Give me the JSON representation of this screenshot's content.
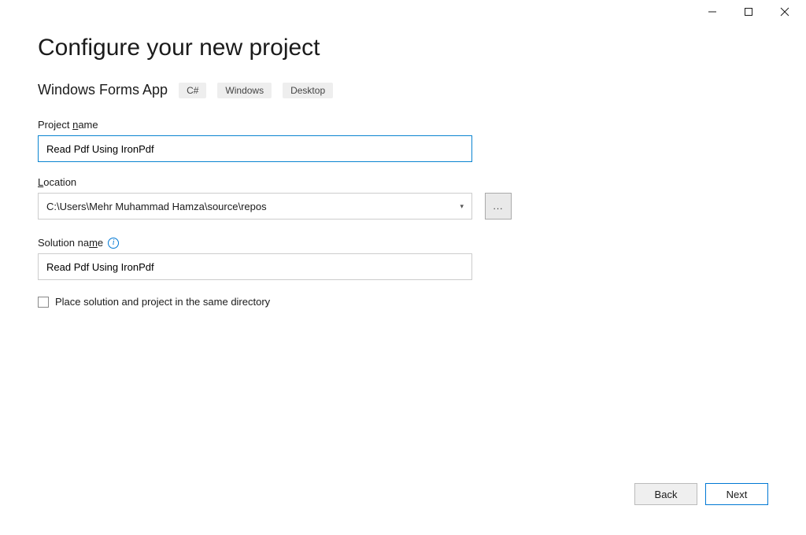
{
  "window_controls": {
    "minimize": "minimize",
    "maximize": "maximize",
    "close": "close"
  },
  "heading": "Configure your new project",
  "template": {
    "name": "Windows Forms App",
    "tags": [
      "C#",
      "Windows",
      "Desktop"
    ]
  },
  "fields": {
    "project_name": {
      "label_pre": "Project ",
      "label_ul": "n",
      "label_post": "ame",
      "value": "Read Pdf Using IronPdf"
    },
    "location": {
      "label_ul": "L",
      "label_post": "ocation",
      "value": "C:\\Users\\Mehr Muhammad Hamza\\source\\repos",
      "browse": "..."
    },
    "solution_name": {
      "label_pre": "Solution na",
      "label_ul": "m",
      "label_post": "e",
      "info": "i",
      "value": "Read Pdf Using IronPdf"
    },
    "same_dir": {
      "label_pre": "Place solution and project in the same ",
      "label_ul": "d",
      "label_post": "irectory",
      "checked": false
    }
  },
  "buttons": {
    "back_ul": "B",
    "back_post": "ack",
    "next_ul": "N",
    "next_post": "ext"
  }
}
